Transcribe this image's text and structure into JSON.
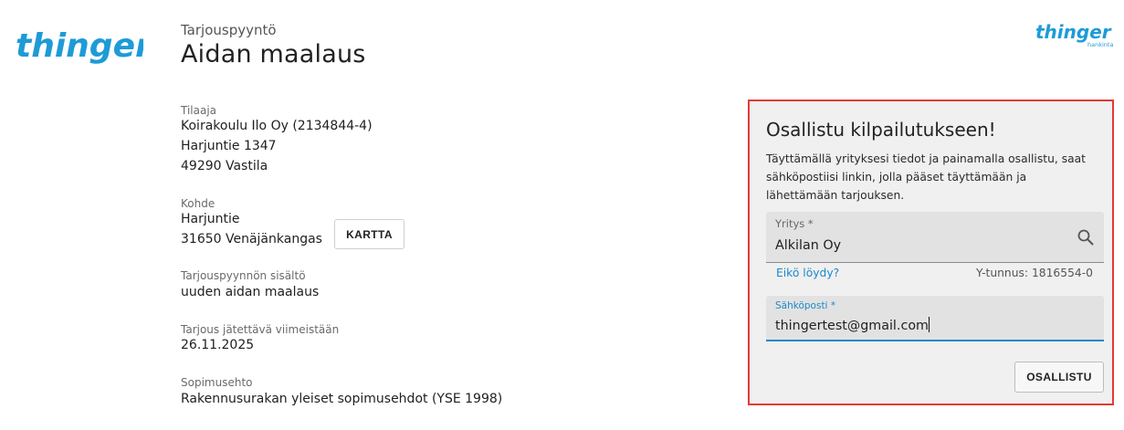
{
  "brand": {
    "logo_main": "thinger",
    "logo_small": "thinger",
    "logo_small_sub": "hankinta",
    "color": "#1e9bd7"
  },
  "header": {
    "kicker": "Tarjouspyyntö",
    "title": "Aidan maalaus"
  },
  "details": {
    "client_label": "Tilaaja",
    "client_lines": [
      "Koirakoulu Ilo Oy (2134844-4)",
      "Harjuntie 1347",
      "49290 Vastila"
    ],
    "site_label": "Kohde",
    "site_lines": [
      "Harjuntie",
      "31650 Venäjänkangas"
    ],
    "map_button": "KARTTA",
    "content_label": "Tarjouspyynnön sisältö",
    "content_value": "uuden aidan maalaus",
    "deadline_label": "Tarjous jätettävä viimeistään",
    "deadline_value": "26.11.2025",
    "terms_label": "Sopimusehto",
    "terms_value": "Rakennusurakan yleiset sopimusehdot (YSE 1998)"
  },
  "panel": {
    "title": "Osallistu kilpailutukseen!",
    "description": "Täyttämällä yrityksesi tiedot ja painamalla osallistu, saat sähköpostiisi linkin, jolla pääset täyttämään ja lähettämään tarjouksen.",
    "company_label": "Yritys *",
    "company_value": "Alkilan Oy",
    "not_found_link": "Eikö löydy?",
    "business_id": "Y-tunnus: 1816554-0",
    "email_label": "Sähköposti *",
    "email_value": "thingertest@gmail.com",
    "submit_label": "OSALLISTU",
    "highlight_color": "#e53935",
    "accent_color": "#1e88c9"
  },
  "icons": {
    "search": "search-icon"
  }
}
